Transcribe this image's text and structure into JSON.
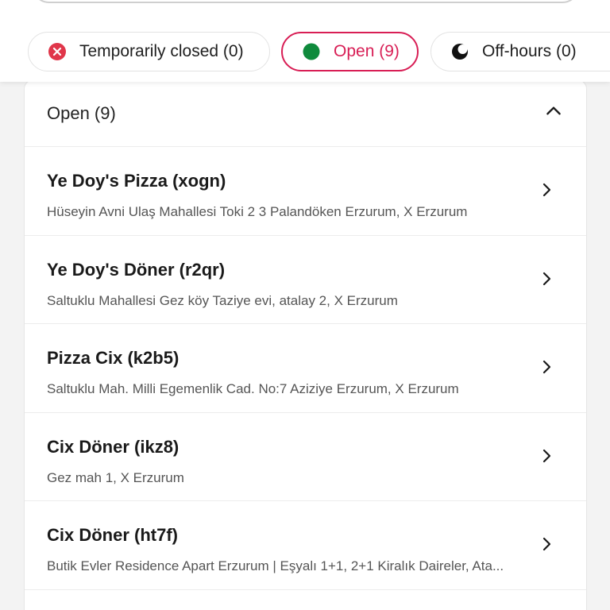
{
  "filters": {
    "closed": {
      "label": "Temporarily closed (0)",
      "icon": "close-circle-icon",
      "color": "#e0364a"
    },
    "open": {
      "label": "Open (9)",
      "icon": "green-dot-icon",
      "color": "#0f8a3c",
      "active": true
    },
    "off": {
      "label": "Off-hours (0)",
      "icon": "moon-icon",
      "color": "#111111"
    }
  },
  "accent": "#d81e55",
  "section": {
    "title": "Open (9)",
    "toggle_icon": "chevron-up-icon"
  },
  "stores": [
    {
      "name": "Ye Doy's Pizza (xogn)",
      "address": "Hüseyin Avni Ulaş Mahallesi Toki 2 3 Palandöken Erzurum, X Erzurum"
    },
    {
      "name": "Ye Doy's Döner (r2qr)",
      "address": "Saltuklu Mahallesi Gez köy Taziye evi, atalay 2, X Erzurum"
    },
    {
      "name": "Pizza Cix (k2b5)",
      "address": "Saltuklu Mah. Milli Egemenlik Cad. No:7 Aziziye Erzurum, X Erzurum"
    },
    {
      "name": "Cix Döner (ikz8)",
      "address": "Gez mah 1, X Erzurum"
    },
    {
      "name": "Cix Döner (ht7f)",
      "address": "Butik Evler Residence Apart Erzurum | Eşyalı 1+1, 2+1 Kiralık Daireler, Ata..."
    }
  ]
}
